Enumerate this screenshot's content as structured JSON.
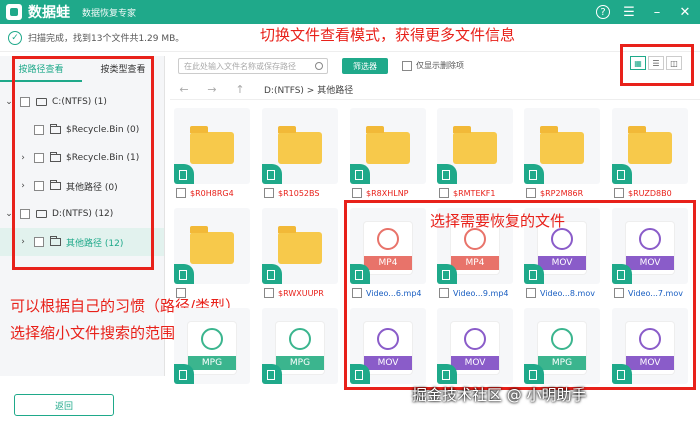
{
  "titlebar": {
    "app_name": "数据蛙",
    "subtitle": "数据恢复专家"
  },
  "status": {
    "text": "扫描完成，找到13个文件共1.29 MB。"
  },
  "annotations": {
    "top": "切换文件查看模式，获得更多文件信息",
    "middle": "选择需要恢复的文件",
    "left_line1": "可以根据自己的习惯（路径/类型）",
    "left_line2": "选择缩小文件搜索的范围"
  },
  "sidebar": {
    "tabs": [
      "按路径查看",
      "按类型查看"
    ],
    "items": [
      {
        "label": "C:(NTFS) (1)",
        "level": 0,
        "chevron": "⌄",
        "icon": "drive-icon"
      },
      {
        "label": "$Recycle.Bin (0)",
        "level": 1,
        "chevron": "",
        "icon": "folder-icon"
      },
      {
        "label": "$Recycle.Bin (1)",
        "level": 1,
        "chevron": "›",
        "icon": "folder-icon"
      },
      {
        "label": "其他路径 (0)",
        "level": 1,
        "chevron": "›",
        "icon": "folder-icon"
      },
      {
        "label": "D:(NTFS) (12)",
        "level": 0,
        "chevron": "⌄",
        "icon": "drive-icon"
      },
      {
        "label": "其他路径 (12)",
        "level": 1,
        "chevron": "›",
        "icon": "folder-icon",
        "selected": true
      }
    ]
  },
  "toolbar": {
    "search_placeholder": "在此处输入文件名称或保存路径",
    "filter_label": "筛选器",
    "deleted_only_label": "仅显示删除项"
  },
  "pathbar": {
    "path": "D:(NTFS) > 其他路径"
  },
  "files": [
    {
      "name": "$R0H8RG4",
      "type": "folder"
    },
    {
      "name": "$R1052BS",
      "type": "folder"
    },
    {
      "name": "$R8XHLNP",
      "type": "folder"
    },
    {
      "name": "$RMTEKF1",
      "type": "folder"
    },
    {
      "name": "$RP2M86R",
      "type": "folder"
    },
    {
      "name": "$RUZD8B0",
      "type": "folder"
    },
    {
      "name": "",
      "type": "folder"
    },
    {
      "name": "$RWXUUPR",
      "type": "folder"
    },
    {
      "name": "Video...6.mp4",
      "type": "MP4"
    },
    {
      "name": "Video...9.mp4",
      "type": "MP4"
    },
    {
      "name": "Video...8.mov",
      "type": "MOV"
    },
    {
      "name": "Video...7.mov",
      "type": "MOV"
    },
    {
      "name": "",
      "type": "MPG"
    },
    {
      "name": "",
      "type": "MPG"
    },
    {
      "name": "",
      "type": "MOV"
    },
    {
      "name": "",
      "type": "MOV"
    },
    {
      "name": "",
      "type": "MPG"
    },
    {
      "name": "",
      "type": "MOV"
    }
  ],
  "colors": {
    "accent": "#1fa98a",
    "annotation": "#e8211a",
    "mp4": "#e8736a",
    "mov": "#8a5cc9",
    "mpg": "#3bb58e"
  },
  "footer": {
    "back_label": "返回"
  },
  "watermark": "掘金技术社区 @ 小明助手"
}
